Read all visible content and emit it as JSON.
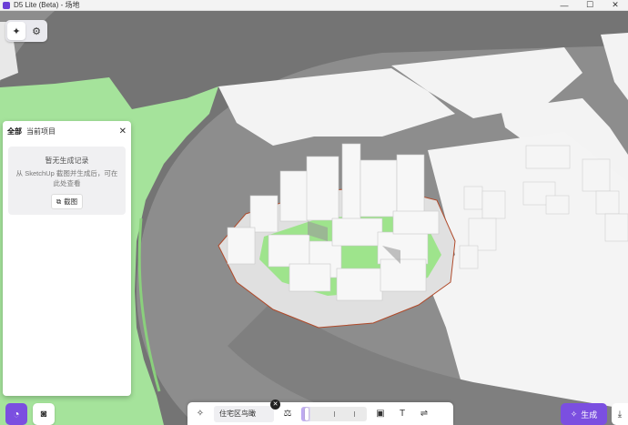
{
  "window": {
    "title": "D5 Lite (Beta) - 场地",
    "minimize_glyph": "—",
    "maximize_glyph": "☐",
    "close_glyph": "✕"
  },
  "view_toggle": {
    "icons": [
      "sparkle-icon",
      "settings-icon"
    ]
  },
  "history_panel": {
    "tabs": [
      "全部",
      "当前项目"
    ],
    "active_tab": 0,
    "close_glyph": "✕",
    "empty_title": "暂无生成记录",
    "empty_description": "从 SketchUp 截图并生成后，可在此处查看",
    "screenshot_button": "截图"
  },
  "bottom_toolbar": {
    "preset": "住宅区鸟瞰",
    "preset_clear_glyph": "✕",
    "strength_value": 0.05,
    "icons": [
      "sparkle-icon",
      "balance-icon",
      "image-icon",
      "text-icon",
      "sliders-icon"
    ],
    "text_glyph": "T",
    "sliders_glyph": "⇌"
  },
  "generate_button": "生成",
  "colors": {
    "accent": "#7b4fe0",
    "ground": "#8c8c8c",
    "road": "#7a7a7a",
    "grass": "#a6e39a",
    "building": "#f2f2f2"
  }
}
